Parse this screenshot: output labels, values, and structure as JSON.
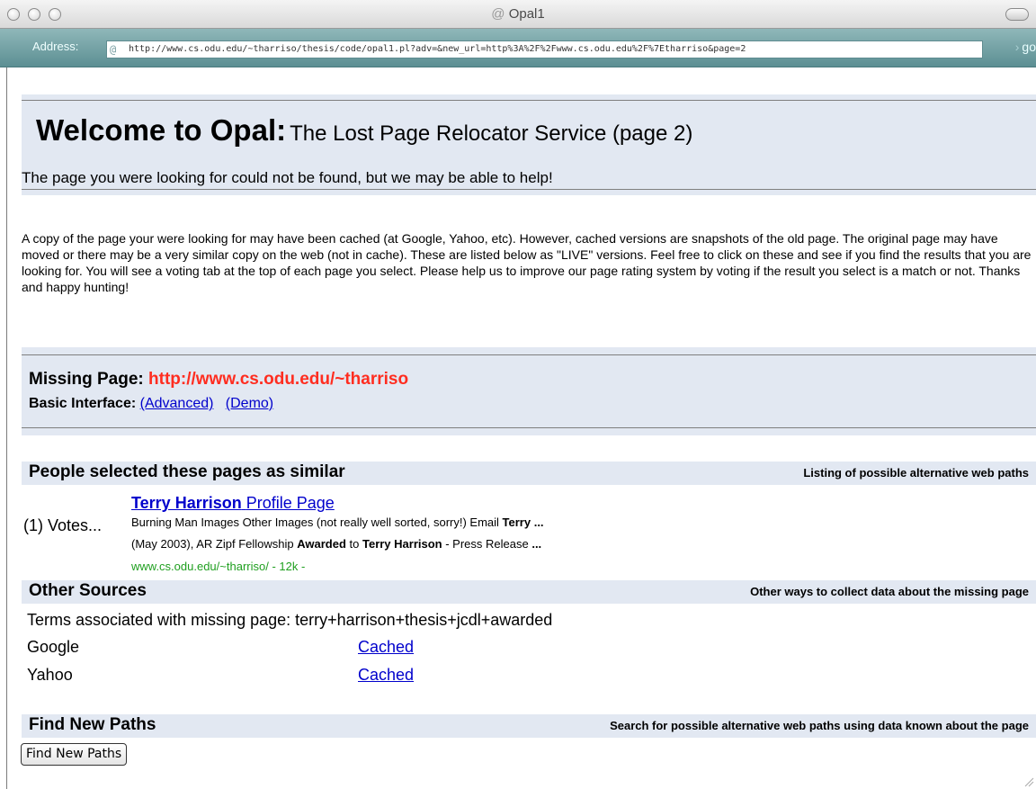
{
  "window": {
    "title": "Opal1",
    "address_label": "Address:",
    "url": "http://www.cs.odu.edu/~tharriso/thesis/code/opal1.pl?adv=&new_url=http%3A%2F%2Fwww.cs.odu.edu%2F%7Etharriso&page=2",
    "go_label": "go"
  },
  "welcome": {
    "title": "Welcome to Opal:",
    "subtitle": "The Lost Page Relocator Service (page 2)",
    "line": "The page you were looking for could not be found, but we may be able to help!"
  },
  "intro": "A copy of the page your were looking for may have been cached (at Google, Yahoo, etc). However, cached versions are snapshots of the old page. The original page may have moved or there may be a very similar copy on the web (not in cache). These are listed below as \"LIVE\" versions. Feel free to click on these and see if you find the results that you are looking for. You will see a voting tab at the top of each page you select. Please help us to improve our page rating system by voting if the result you select is a match or not. Thanks and happy hunting!",
  "missing": {
    "label": "Missing Page:",
    "url": "http://www.cs.odu.edu/~tharriso",
    "interface_label": "Basic Interface:",
    "advanced_link": "(Advanced)",
    "demo_link": "(Demo)"
  },
  "similar": {
    "title": "People selected these pages as similar",
    "note": "Listing of possible alternative web paths",
    "results": [
      {
        "votes": "(1) Votes...",
        "title_bold": "Terry Harrison",
        "title_rest": "Profile Page",
        "snippet1_a": "Burning Man Images Other Images (not really well sorted, sorry!) Email ",
        "snippet1_b": "Terry ...",
        "snippet2_a": "(May 2003), AR Zipf Fellowship ",
        "snippet2_b": "Awarded",
        "snippet2_c": " to ",
        "snippet2_d": "Terry Harrison",
        "snippet2_e": " - Press Release ",
        "snippet2_f": "...",
        "green": "www.cs.odu.edu/~tharriso/ - 12k -"
      }
    ]
  },
  "other": {
    "title": "Other Sources",
    "note": "Other ways to collect data about the missing page",
    "terms": "Terms associated with missing page: terry+harrison+thesis+jcdl+awarded",
    "sources": [
      {
        "name": "Google",
        "link": "Cached"
      },
      {
        "name": "Yahoo",
        "link": "Cached"
      }
    ]
  },
  "find": {
    "title": "Find New Paths",
    "note": "Search for possible alternative web paths using data known about the page",
    "button": "Find New Paths"
  }
}
